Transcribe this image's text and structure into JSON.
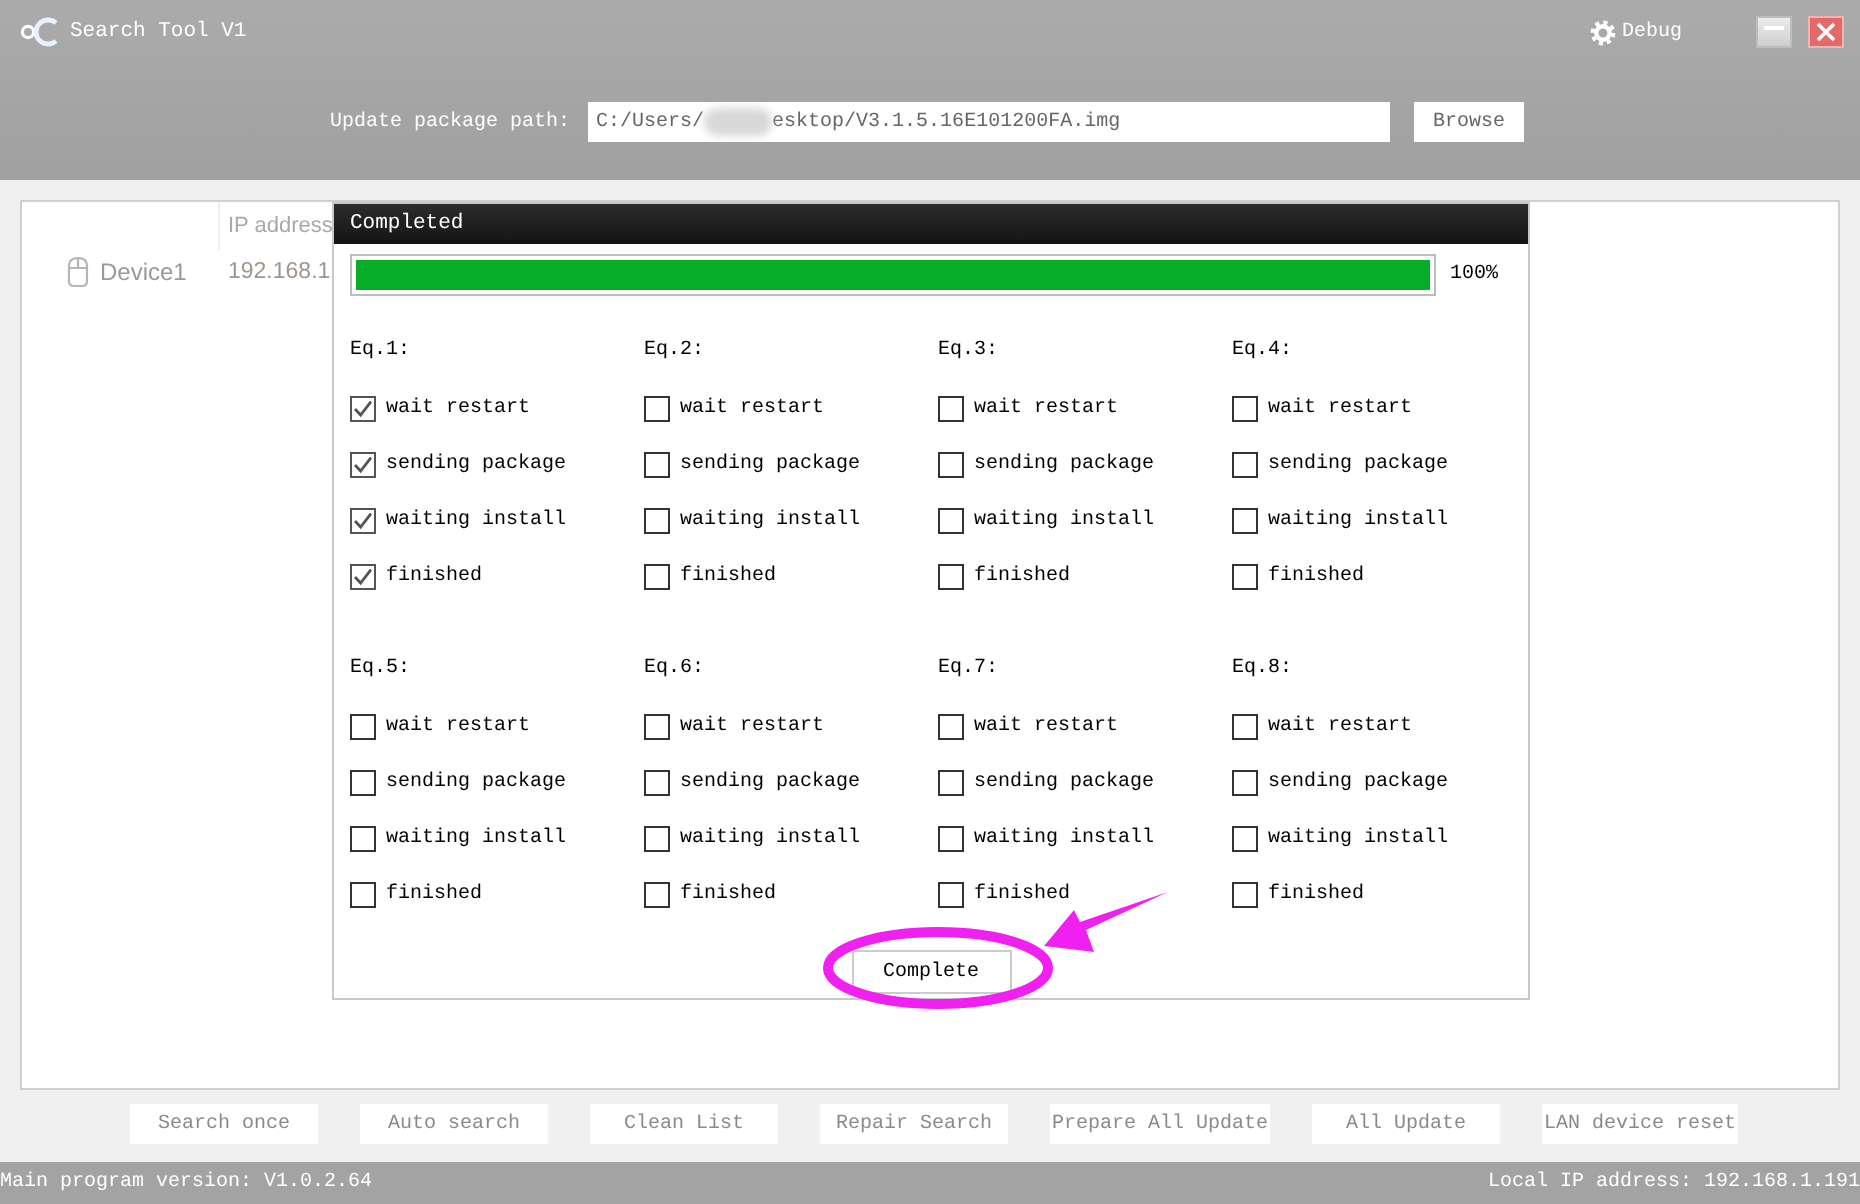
{
  "window": {
    "title": "Search Tool V1",
    "debug_label": "Debug"
  },
  "update_path": {
    "label": "Update package path:",
    "value_parts": [
      "C:/Users/",
      "esktop/V3.1.5.16E101200FA.img"
    ],
    "browse_button": "Browse"
  },
  "table": {
    "columns": [
      "IP address"
    ],
    "rows": [
      {
        "column_1": "Device1",
        "ip_address": "192.168.1"
      }
    ]
  },
  "dialog": {
    "title": "Completed",
    "progress": {
      "level": 1,
      "reading": "100%"
    },
    "groups": [
      {
        "label": "Eq.1:",
        "steps": [
          {
            "label": "wait restart",
            "checked": true
          },
          {
            "label": "sending package",
            "checked": true
          },
          {
            "label": "waiting install",
            "checked": true
          },
          {
            "label": "finished",
            "checked": true
          }
        ]
      },
      {
        "label": "Eq.2:",
        "steps": [
          {
            "label": "wait restart",
            "checked": false
          },
          {
            "label": "sending package",
            "checked": false
          },
          {
            "label": "waiting install",
            "checked": false
          },
          {
            "label": "finished",
            "checked": false
          }
        ]
      },
      {
        "label": "Eq.3:",
        "steps": [
          {
            "label": "wait restart",
            "checked": false
          },
          {
            "label": "sending package",
            "checked": false
          },
          {
            "label": "waiting install",
            "checked": false
          },
          {
            "label": "finished",
            "checked": false
          }
        ]
      },
      {
        "label": "Eq.4:",
        "steps": [
          {
            "label": "wait restart",
            "checked": false
          },
          {
            "label": "sending package",
            "checked": false
          },
          {
            "label": "waiting install",
            "checked": false
          },
          {
            "label": "finished",
            "checked": false
          }
        ]
      },
      {
        "label": "Eq.5:",
        "steps": [
          {
            "label": "wait restart",
            "checked": false
          },
          {
            "label": "sending package",
            "checked": false
          },
          {
            "label": "waiting install",
            "checked": false
          },
          {
            "label": "finished",
            "checked": false
          }
        ]
      },
      {
        "label": "Eq.6:",
        "steps": [
          {
            "label": "wait restart",
            "checked": false
          },
          {
            "label": "sending package",
            "checked": false
          },
          {
            "label": "waiting install",
            "checked": false
          },
          {
            "label": "finished",
            "checked": false
          }
        ]
      },
      {
        "label": "Eq.7:",
        "steps": [
          {
            "label": "wait restart",
            "checked": false
          },
          {
            "label": "sending package",
            "checked": false
          },
          {
            "label": "waiting install",
            "checked": false
          },
          {
            "label": "finished",
            "checked": false
          }
        ]
      },
      {
        "label": "Eq.8:",
        "steps": [
          {
            "label": "wait restart",
            "checked": false
          },
          {
            "label": "sending package",
            "checked": false
          },
          {
            "label": "waiting install",
            "checked": false
          },
          {
            "label": "finished",
            "checked": false
          }
        ]
      }
    ],
    "button": "Complete"
  },
  "buttons": [
    "Search once",
    "Auto search",
    "Clean List",
    "Repair Search",
    "Prepare All Update",
    "All Update",
    "LAN device reset"
  ],
  "status_bar": {
    "left": "Main program version: V1.0.2.64",
    "right": "Local IP address: 192.168.1.191"
  }
}
